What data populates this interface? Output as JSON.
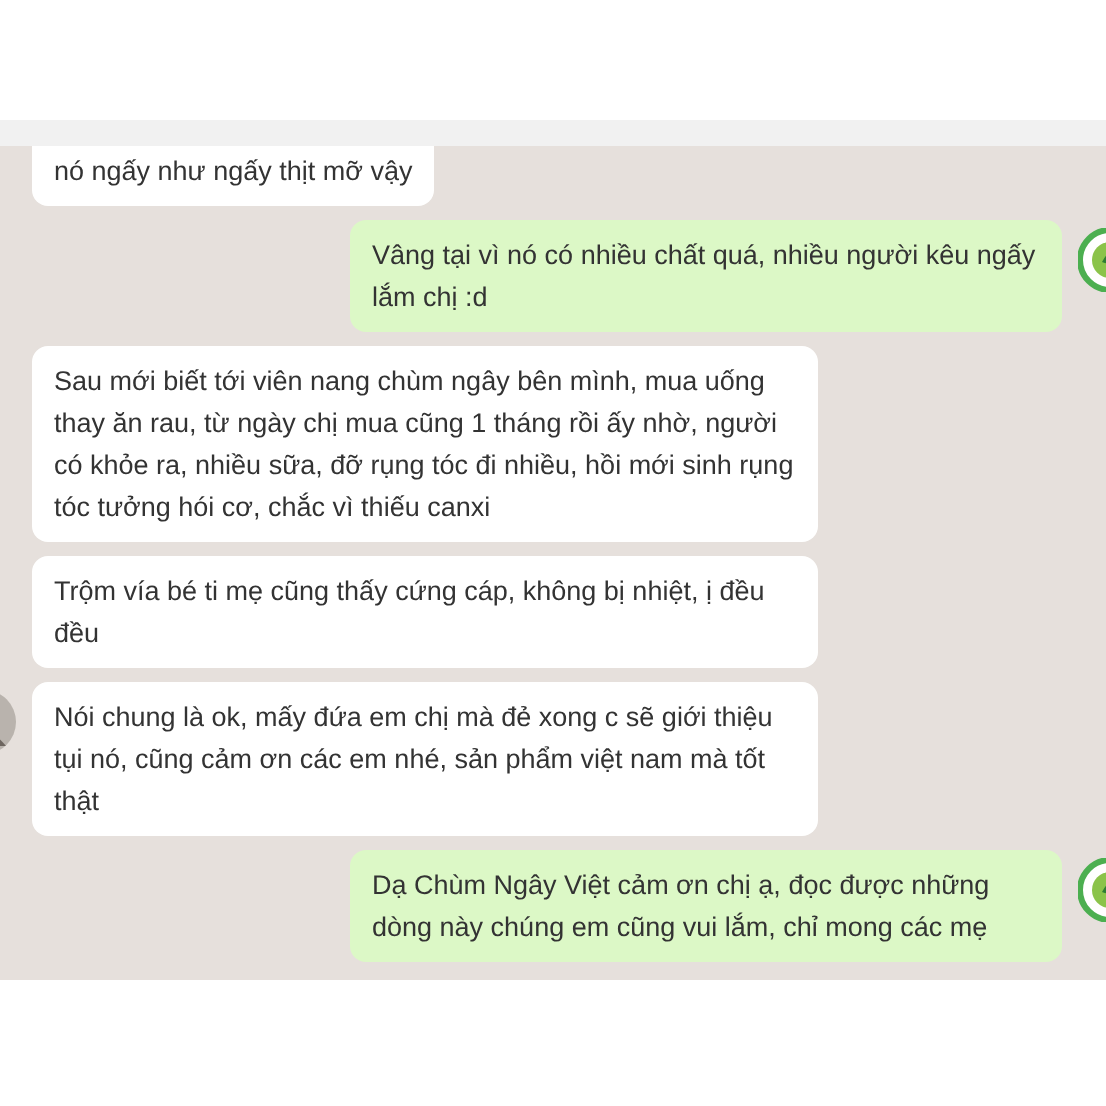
{
  "messages": [
    {
      "kind": "incoming",
      "text": "nó ngấy như ngấy thịt mỡ vậy",
      "avatar": false
    },
    {
      "kind": "outgoing",
      "text": "Vâng tại vì nó có nhiều chất quá, nhiều người kêu ngấy lắm chị :d",
      "avatar": true
    },
    {
      "kind": "incoming",
      "text": "Sau mới biết tới viên nang chùm ngây bên mình, mua uống thay ăn rau, từ ngày chị mua cũng 1 tháng rồi ấy nhờ, người có khỏe ra, nhiều sữa, đỡ rụng tóc đi nhiều, hồi mới sinh rụng tóc tưởng hói cơ, chắc vì thiếu canxi",
      "avatar": false
    },
    {
      "kind": "incoming",
      "text": "Trộm vía bé ti mẹ cũng thấy cứng cáp, không bị nhiệt, ị đều đều",
      "avatar": false
    },
    {
      "kind": "incoming",
      "text": "Nói chung là ok, mấy đứa em chị mà đẻ xong c sẽ giới thiệu tụi nó, cũng cảm ơn các em nhé, sản phẩm việt nam mà tốt thật",
      "avatar": true
    },
    {
      "kind": "outgoing",
      "text": "Dạ Chùm Ngây Việt cảm ơn chị ạ, đọc được những dòng này chúng em cũng vui lắm, chỉ mong các mẹ",
      "avatar": true
    }
  ]
}
